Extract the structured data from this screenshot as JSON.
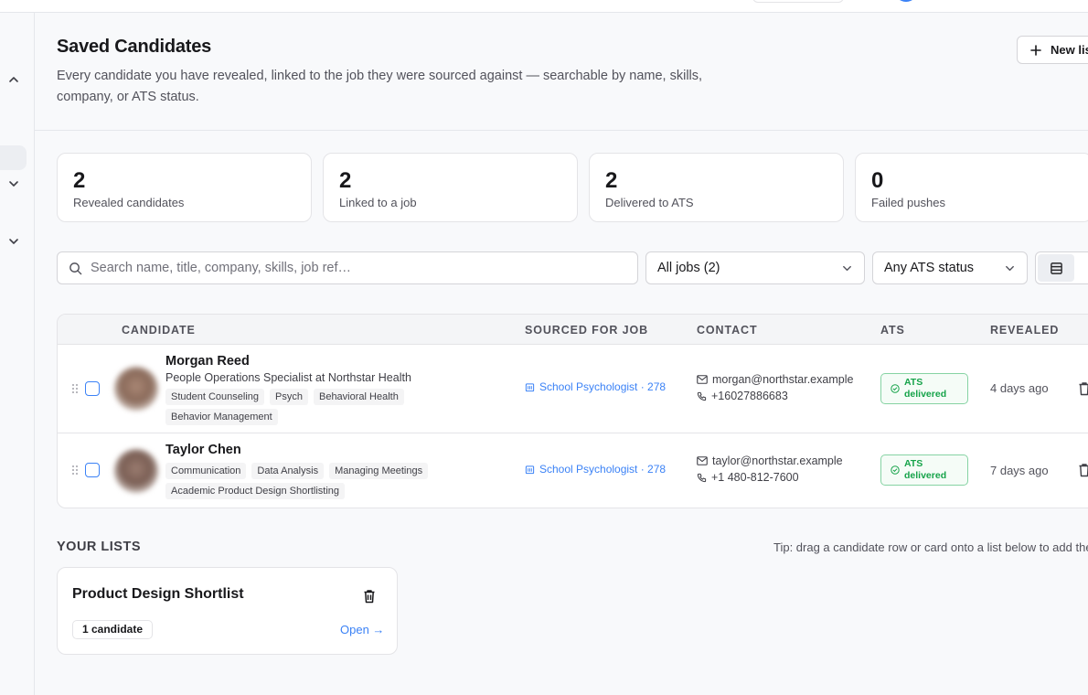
{
  "header": {
    "title": "Saved Candidates",
    "description": "Every candidate you have revealed, linked to the job they were sourced against — searchable by name, skills, company, or ATS status.",
    "new_list_label": "New list"
  },
  "stats": [
    {
      "value": "2",
      "label": "Revealed candidates"
    },
    {
      "value": "2",
      "label": "Linked to a job"
    },
    {
      "value": "2",
      "label": "Delivered to ATS"
    },
    {
      "value": "0",
      "label": "Failed pushes"
    }
  ],
  "filters": {
    "search_placeholder": "Search name, title, company, skills, job ref…",
    "jobs_select": "All jobs (2)",
    "ats_select": "Any ATS status"
  },
  "table": {
    "headers": [
      "CANDIDATE",
      "SOURCED FOR JOB",
      "CONTACT",
      "ATS",
      "REVEALED"
    ],
    "rows": [
      {
        "name": "Morgan Reed",
        "title": "People Operations Specialist at Northstar Health",
        "tags": [
          "Student Counseling",
          "Psych",
          "Behavioral Health",
          "Behavior Management"
        ],
        "job": "School Psychologist · 278",
        "email": "morgan@northstar.example",
        "phone": "+16027886683",
        "ats_line1": "ATS",
        "ats_line2": "delivered",
        "revealed": "4 days ago"
      },
      {
        "name": "Taylor Chen",
        "title": "",
        "tags": [
          "Communication",
          "Data Analysis",
          "Managing Meetings",
          "Academic Product Design Shortlisting"
        ],
        "job": "School Psychologist · 278",
        "email": "taylor@northstar.example",
        "phone": "+1 480-812-7600",
        "ats_line1": "ATS",
        "ats_line2": "delivered",
        "revealed": "7 days ago"
      }
    ]
  },
  "lists": {
    "heading": "YOUR LISTS",
    "tip": "Tip: drag a candidate row or card onto a list below to add them.",
    "items": [
      {
        "name": "Product Design Shortlist",
        "count": "1 candidate",
        "open_label": "Open →"
      }
    ]
  },
  "colors": {
    "accent": "#3b82f6",
    "success": "#16a34a"
  }
}
